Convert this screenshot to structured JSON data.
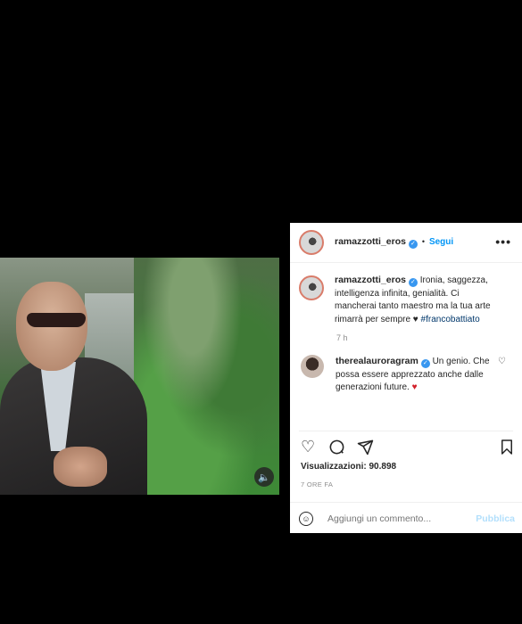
{
  "post": {
    "username": "ramazzotti_eros",
    "follow_label": "Segui",
    "separator": "•",
    "more_label": "•••",
    "caption_text": "Ironia, saggezza, intelligenza infinita, genialità. Ci mancherai tanto maestro ma la tua arte rimarrà per sempre ♥",
    "hashtag": "#francobattiato",
    "caption_time": "7 h",
    "views_label": "Visualizzazioni: 90.898",
    "posted_label": "7 ORE FA"
  },
  "comment": {
    "username": "therealauroragram",
    "text": "Un genio. Che possa essere apprezzato anche dalle generazioni future.",
    "heart_emoji": "♥"
  },
  "add_comment": {
    "placeholder": "Aggiungi un commento...",
    "publish_label": "Pubblica"
  },
  "icons": {
    "like": "heart-outline",
    "comment": "speech-bubble",
    "share": "paper-plane",
    "save": "bookmark",
    "sound": "speaker",
    "emoji": "smiley"
  },
  "colors": {
    "accent": "#0095f6",
    "verified": "#3897f0",
    "publish_disabled": "#b2dffc"
  }
}
